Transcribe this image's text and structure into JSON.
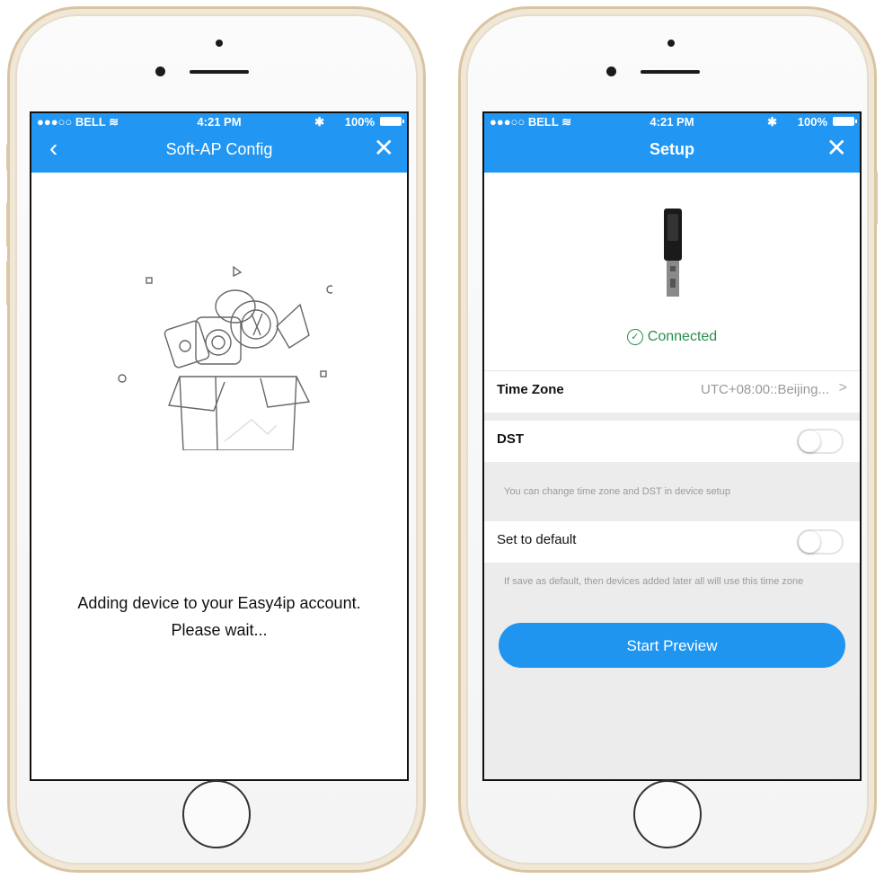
{
  "status": {
    "carrier": "●●●○○ BELL ≋",
    "time": "4:21 PM",
    "battery": "100%"
  },
  "left_screen": {
    "title": "Soft-AP Config",
    "back": "‹",
    "close": "✕",
    "message_line1": "Adding device to your Easy4ip account.",
    "message_line2": "Please wait..."
  },
  "right_screen": {
    "title": "Setup",
    "close": "✕",
    "connected": "Connected",
    "time_zone": {
      "label": "Time Zone",
      "value": "UTC+08:00::Beijing...",
      "chevron": ">"
    },
    "dst": {
      "label": "DST",
      "on": false
    },
    "note1": "You can change time zone and DST in device setup",
    "set_default": {
      "label": "Set to default",
      "on": false
    },
    "note2": "If save as default, then devices added later all will use this time zone",
    "start_button": "Start Preview"
  },
  "colors": {
    "accent": "#2196f3",
    "connected": "#2b8e4e"
  }
}
